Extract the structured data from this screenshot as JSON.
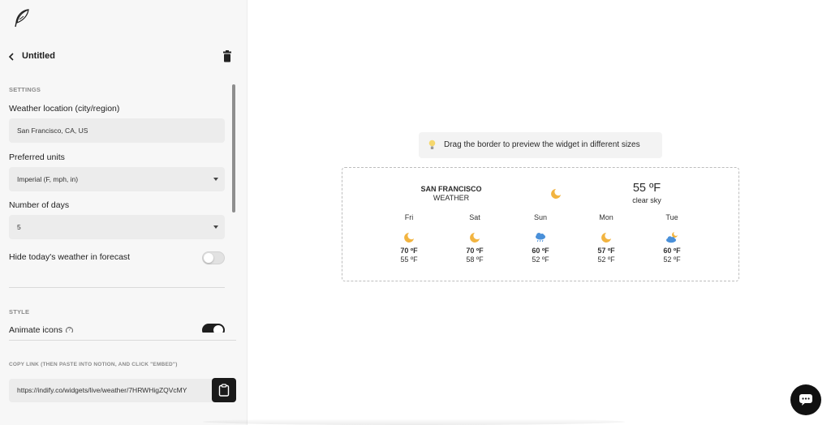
{
  "sidebar": {
    "logo_icon": "quill-feather-icon",
    "title": "Untitled",
    "settings": {
      "section_label": "SETTINGS",
      "location_label": "Weather location (city/region)",
      "location_value": "San Francisco, CA, US",
      "units_label": "Preferred units",
      "units_value": "Imperial (F, mph, in)",
      "days_label": "Number of days",
      "days_value": "5",
      "hide_today_label": "Hide today's weather in forecast",
      "hide_today_on": false
    },
    "style": {
      "section_label": "STYLE",
      "animate_label": "Animate icons",
      "animate_on": true
    },
    "copy": {
      "label": "COPY LINK (THEN PASTE INTO NOTION, AND CLICK \"EMBED\")",
      "url": "https://indify.co/widgets/live/weather/7HRWHigZQVcMY"
    }
  },
  "preview": {
    "hint": "Drag the border to preview the widget in different sizes",
    "widget": {
      "city": "SAN FRANCISCO",
      "city_sub": "WEATHER",
      "current_temp": "55 ºF",
      "current_condition": "clear sky",
      "current_icon": "moon-icon",
      "days": [
        {
          "name": "Fri",
          "icon": "moon-icon",
          "high": "70 ºF",
          "low": "55 ºF"
        },
        {
          "name": "Sat",
          "icon": "moon-icon",
          "high": "70 ºF",
          "low": "58 ºF"
        },
        {
          "name": "Sun",
          "icon": "rain-cloud-icon",
          "high": "60 ºF",
          "low": "52 ºF"
        },
        {
          "name": "Mon",
          "icon": "moon-icon",
          "high": "57 ºF",
          "low": "52 ºF"
        },
        {
          "name": "Tue",
          "icon": "cloud-moon-icon",
          "high": "60 ºF",
          "low": "52 ºF"
        }
      ]
    }
  },
  "colors": {
    "moon": "#f2b440",
    "cloud": "#4a90d9",
    "toggle_on": "#1e1e1e"
  }
}
